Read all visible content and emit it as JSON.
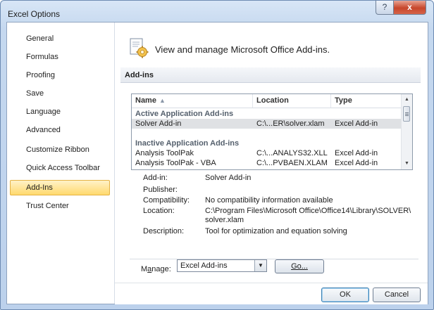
{
  "window": {
    "title": "Excel Options",
    "help_label": "?",
    "close_label": "x"
  },
  "nav": {
    "items": [
      "General",
      "Formulas",
      "Proofing",
      "Save",
      "Language",
      "Advanced",
      "Customize Ribbon",
      "Quick Access Toolbar",
      "Add-Ins",
      "Trust Center"
    ],
    "selected": "Add-Ins"
  },
  "header": {
    "text": "View and manage Microsoft Office Add-ins."
  },
  "section": {
    "title": "Add-ins"
  },
  "table": {
    "columns": {
      "name": "Name",
      "location": "Location",
      "type": "Type"
    },
    "groups": [
      {
        "title": "Active Application Add-ins",
        "rows": [
          {
            "name": "Solver Add-in",
            "location": "C:\\...ER\\solver.xlam",
            "type": "Excel Add-in",
            "selected": true
          }
        ]
      },
      {
        "title": "Inactive Application Add-ins",
        "rows": [
          {
            "name": "Analysis ToolPak",
            "location": "C:\\...ANALYS32.XLL",
            "type": "Excel Add-in"
          },
          {
            "name": "Analysis ToolPak - VBA",
            "location": "C:\\...PVBAEN.XLAM",
            "type": "Excel Add-in"
          }
        ]
      }
    ]
  },
  "details": {
    "addin_label": "Add-in:",
    "addin_value": "Solver Add-in",
    "publisher_label": "Publisher:",
    "publisher_value": "",
    "compat_label": "Compatibility:",
    "compat_value": "No compatibility information available",
    "location_label": "Location:",
    "location_value_1": "C:\\Program Files\\Microsoft Office\\Office14\\Library\\SOLVER\\",
    "location_value_2": "solver.xlam",
    "desc_label": "Description:",
    "desc_value": "Tool for optimization and equation solving"
  },
  "manage": {
    "label_prefix": "M",
    "label_accel": "a",
    "label_suffix": "nage:",
    "selected": "Excel Add-ins",
    "go_label": "Go..."
  },
  "footer": {
    "ok": "OK",
    "cancel": "Cancel"
  }
}
